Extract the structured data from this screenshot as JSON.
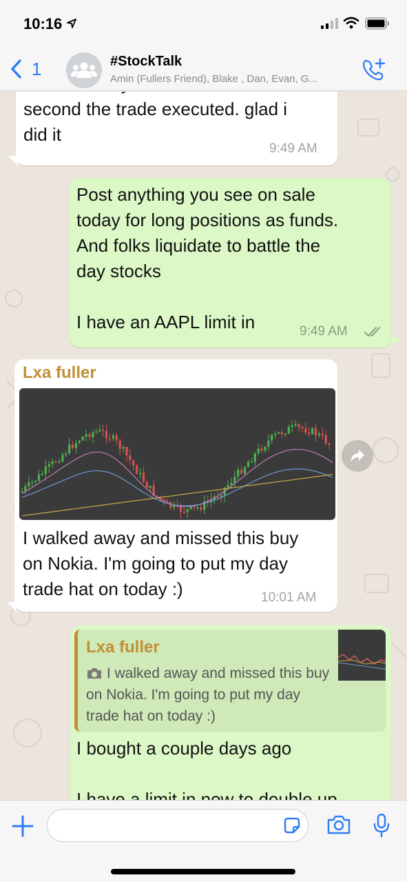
{
  "status_bar": {
    "time": "10:16"
  },
  "header": {
    "back_count": "1",
    "title": "#StockTalk",
    "members": "Amin (Fullers Friend), Blake , Dan, Evan, G..."
  },
  "messages": [
    {
      "direction": "in",
      "text": "had such buyers remorse the\nsecond the trade executed. glad i\ndid it",
      "time": "9:49 AM"
    },
    {
      "direction": "out",
      "text": "Post anything you see on sale\ntoday for long positions as funds.\nAnd folks liquidate to battle the\nday stocks\n\nI have an AAPL limit in",
      "time": "9:49 AM",
      "status": "read"
    },
    {
      "direction": "in",
      "sender": "Lxa fuller",
      "has_image": true,
      "text": "I walked away and missed this buy\non Nokia. I'm going to put my day\ntrade hat on today :)",
      "time": "10:01 AM"
    },
    {
      "direction": "out",
      "quote": {
        "sender": "Lxa fuller",
        "text": "I walked away and missed this buy on Nokia. I'm going to put my day trade hat on today :)"
      },
      "text": "I bought a couple days ago\n\nI have a limit in now to double up"
    }
  ],
  "input": {
    "placeholder": ""
  },
  "colors": {
    "accent": "#2f7cf6",
    "sender": "#c18f33",
    "out_bubble": "#dcf8c6",
    "in_bubble": "#ffffff",
    "wallpaper": "#ece5dd"
  },
  "icons": [
    "location-arrow-icon",
    "signal-icon",
    "wifi-icon",
    "battery-icon",
    "back-chevron-icon",
    "group-avatar-icon",
    "add-call-icon",
    "forward-icon",
    "read-ticks-icon",
    "camera-small-icon",
    "plus-icon",
    "sticker-icon",
    "camera-icon",
    "mic-icon"
  ]
}
